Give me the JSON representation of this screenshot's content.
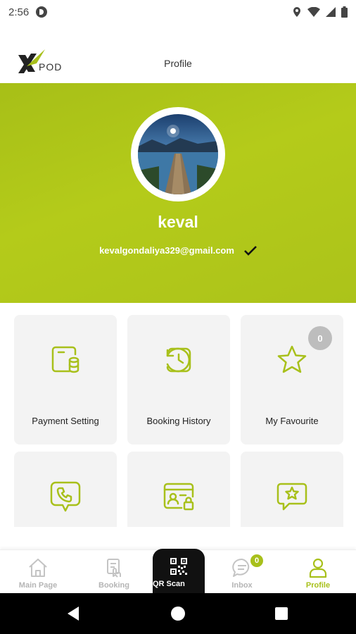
{
  "status_bar": {
    "time": "2:56"
  },
  "header": {
    "logo_text": "POD",
    "title": "Profile"
  },
  "profile": {
    "name": "keval",
    "email": "kevalgondaliya329@gmail.com"
  },
  "tiles": [
    {
      "label": "Payment Setting",
      "icon": "wallet-icon"
    },
    {
      "label": "Booking History",
      "icon": "history-icon"
    },
    {
      "label": "My Favourite",
      "icon": "star-icon",
      "badge": "0"
    },
    {
      "label": "",
      "icon": "phone-chat-icon"
    },
    {
      "label": "",
      "icon": "id-lock-icon"
    },
    {
      "label": "",
      "icon": "star-chat-icon"
    }
  ],
  "bottom_nav": {
    "items": [
      {
        "label": "Main Page",
        "icon": "home-icon"
      },
      {
        "label": "Booking",
        "icon": "booking-icon"
      },
      {
        "label": "QR Scan",
        "icon": "qr-icon"
      },
      {
        "label": "Inbox",
        "icon": "inbox-icon",
        "badge": "0"
      },
      {
        "label": "Profile",
        "icon": "profile-icon"
      }
    ],
    "active": "Profile"
  },
  "colors": {
    "accent": "#a8c01b",
    "tile_bg": "#f3f3f3",
    "nav_inactive": "#b5b5b5"
  }
}
